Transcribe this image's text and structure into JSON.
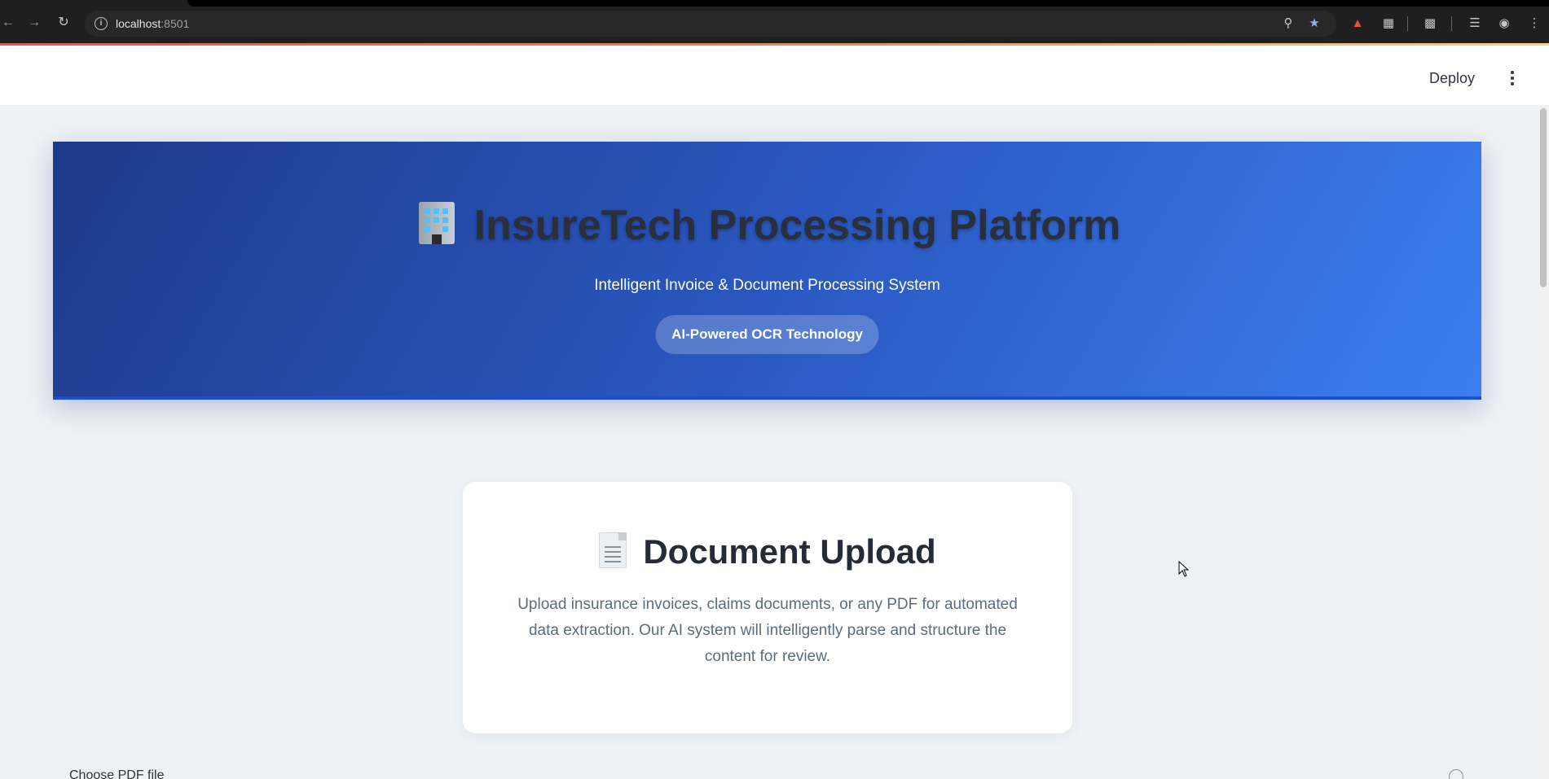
{
  "browser": {
    "url_host": "localhost",
    "url_port": ":8501",
    "back_icon": "arrow-left-icon",
    "forward_icon": "arrow-right-icon",
    "reload_icon": "reload-icon",
    "accent": "#8ab4f8"
  },
  "app_header": {
    "deploy_label": "Deploy",
    "menu_icon": "kebab-menu-icon"
  },
  "hero": {
    "title": "InsureTech Processing Platform",
    "subtitle": "Intelligent Invoice & Document Processing System",
    "badge": "AI-Powered OCR Technology",
    "icon": "office-building-icon",
    "gradient_start": "#1e3a8a",
    "gradient_end": "#3b7ff0"
  },
  "upload_card": {
    "title": "Document Upload",
    "icon": "document-icon",
    "description": "Upload insurance invoices, claims documents, or any PDF for automated data extraction. Our AI system will intelligently parse and structure the content for review."
  },
  "uploader": {
    "label": "Choose PDF file",
    "help_icon": "help-circle-icon"
  }
}
